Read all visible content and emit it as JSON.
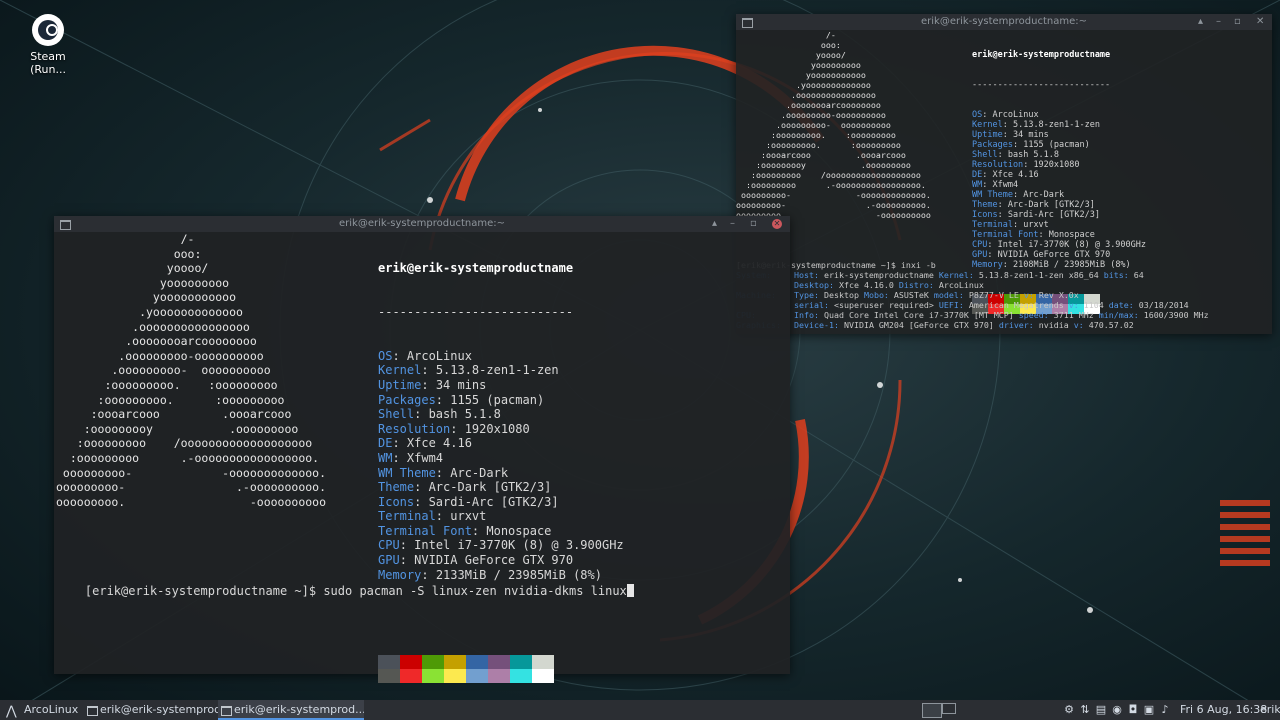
{
  "desktop": {
    "icon_label": "Steam (Run..."
  },
  "big_terminal": {
    "title": "erik@erik-systemproductname:~",
    "ascii_lines": [
      "                  /-",
      "                 ooo:",
      "                yoooo/",
      "               yooooooooo",
      "              yooooooooooo",
      "            .yooooooooooooo",
      "           .oooooooooooooooo",
      "          .oooooooarcoooooooo",
      "         .ooooooooo-oooooooooo",
      "        .ooooooooo-  oooooooooo",
      "       :ooooooooo.    :ooooooooo",
      "      :ooooooooo.      :ooooooooo",
      "     :oooarcooo         .oooarcooo",
      "    :ooooooooy           .ooooooooo",
      "   :ooooooooo    /ooooooooooooooooooo",
      "  :ooooooooo      .-ooooooooooooooooo.",
      " ooooooooo-             -ooooooooooooo.",
      "ooooooooo-                .-oooooooooo.",
      "ooooooooo.                  -oooooooooo"
    ],
    "user_host": "erik@erik-systemproductname",
    "separator": "---------------------------",
    "info": [
      {
        "key": "OS",
        "value": "ArcoLinux"
      },
      {
        "key": "Kernel",
        "value": "5.13.8-zen1-1-zen"
      },
      {
        "key": "Uptime",
        "value": "34 mins"
      },
      {
        "key": "Packages",
        "value": "1155 (pacman)"
      },
      {
        "key": "Shell",
        "value": "bash 5.1.8"
      },
      {
        "key": "Resolution",
        "value": "1920x1080"
      },
      {
        "key": "DE",
        "value": "Xfce 4.16"
      },
      {
        "key": "WM",
        "value": "Xfwm4"
      },
      {
        "key": "WM Theme",
        "value": "Arc-Dark"
      },
      {
        "key": "Theme",
        "value": "Arc-Dark [GTK2/3]"
      },
      {
        "key": "Icons",
        "value": "Sardi-Arc [GTK2/3]"
      },
      {
        "key": "Terminal",
        "value": "urxvt"
      },
      {
        "key": "Terminal Font",
        "value": "Monospace"
      },
      {
        "key": "CPU",
        "value": "Intel i7-3770K (8) @ 3.900GHz"
      },
      {
        "key": "GPU",
        "value": "NVIDIA GeForce GTX 970"
      },
      {
        "key": "Memory",
        "value": "2133MiB / 23985MiB (8%)"
      }
    ],
    "prompt": "[erik@erik-systemproductname ~]$ ",
    "command": "sudo pacman -S linux-zen nvidia-dkms linux"
  },
  "small_terminal": {
    "title": "erik@erik-systemproductname:~",
    "ascii_lines": [
      "                  /-",
      "                 ooo:",
      "                yoooo/",
      "               yooooooooo",
      "              yooooooooooo",
      "            .yooooooooooooo",
      "           .oooooooooooooooo",
      "          .oooooooarcoooooooo",
      "         .ooooooooo-oooooooooo",
      "        .ooooooooo-  oooooooooo",
      "       :ooooooooo.    :ooooooooo",
      "      :ooooooooo.      :ooooooooo",
      "     :oooarcooo         .oooarcooo",
      "    :ooooooooy           .ooooooooo",
      "   :ooooooooo    /ooooooooooooooooooo",
      "  :ooooooooo      .-ooooooooooooooooo.",
      " ooooooooo-             -ooooooooooooo.",
      "ooooooooo-                .-oooooooooo.",
      "ooooooooo.                  -oooooooooo"
    ],
    "user_host": "erik@erik-systemproductname",
    "separator": "---------------------------",
    "info": [
      {
        "key": "OS",
        "value": "ArcoLinux"
      },
      {
        "key": "Kernel",
        "value": "5.13.8-zen1-1-zen"
      },
      {
        "key": "Uptime",
        "value": "34 mins"
      },
      {
        "key": "Packages",
        "value": "1155 (pacman)"
      },
      {
        "key": "Shell",
        "value": "bash 5.1.8"
      },
      {
        "key": "Resolution",
        "value": "1920x1080"
      },
      {
        "key": "DE",
        "value": "Xfce 4.16"
      },
      {
        "key": "WM",
        "value": "Xfwm4"
      },
      {
        "key": "WM Theme",
        "value": "Arc-Dark"
      },
      {
        "key": "Theme",
        "value": "Arc-Dark [GTK2/3]"
      },
      {
        "key": "Icons",
        "value": "Sardi-Arc [GTK2/3]"
      },
      {
        "key": "Terminal",
        "value": "urxvt"
      },
      {
        "key": "Terminal Font",
        "value": "Monospace"
      },
      {
        "key": "CPU",
        "value": "Intel i7-3770K (8) @ 3.900GHz"
      },
      {
        "key": "GPU",
        "value": "NVIDIA GeForce GTX 970"
      },
      {
        "key": "Memory",
        "value": "2108MiB / 23985MiB (8%)"
      }
    ],
    "prompt_line": "[erik@erik-systemproductname ~]$ inxi -b",
    "inxi": [
      {
        "label": "System:",
        "text": [
          {
            "k": "Host:",
            "v": " erik-systemproductname "
          },
          {
            "k": "Kernel:",
            "v": " 5.13.8-zen1-1-zen x86_64 "
          },
          {
            "k": "bits:",
            "v": " 64"
          }
        ]
      },
      {
        "label": "",
        "text": [
          {
            "k": "Desktop:",
            "v": " Xfce 4.16.0 "
          },
          {
            "k": "Distro:",
            "v": " ArcoLinux"
          }
        ]
      },
      {
        "label": "Machine:",
        "text": [
          {
            "k": "Type:",
            "v": " Desktop "
          },
          {
            "k": "Mobo:",
            "v": " ASUSTeK "
          },
          {
            "k": "model:",
            "v": " P8Z77-V LE "
          },
          {
            "k": "v:",
            "v": " Rev X.0x"
          }
        ]
      },
      {
        "label": "",
        "text": [
          {
            "k": "serial:",
            "v": " <superuser required> "
          },
          {
            "k": "UEFI:",
            "v": " American Megatrends "
          },
          {
            "k": "v:",
            "v": " 1104 "
          },
          {
            "k": "date:",
            "v": " 03/18/2014"
          }
        ]
      },
      {
        "label": "CPU:",
        "text": [
          {
            "k": "Info:",
            "v": " Quad Core Intel Core i7-3770K [MT MCP] "
          },
          {
            "k": "speed:",
            "v": " 3711 MHz "
          },
          {
            "k": "min/max:",
            "v": " 1600/3900 MHz"
          }
        ]
      },
      {
        "label": "Graphics:",
        "text": [
          {
            "k": "Device-1:",
            "v": " NVIDIA GM204 [GeForce GTX 970] "
          },
          {
            "k": "driver:",
            "v": " nvidia "
          },
          {
            "k": "v:",
            "v": " 470.57.02"
          }
        ]
      }
    ]
  },
  "palette_top": [
    "#4b5159",
    "#cc0000",
    "#4e9a06",
    "#c4a000",
    "#3465a4",
    "#75507b",
    "#06989a",
    "#d3d7cf"
  ],
  "palette_bottom": [
    "#555753",
    "#ef2929",
    "#8ae234",
    "#fce94f",
    "#729fcf",
    "#ad7fa8",
    "#34e2e2",
    "#ffffff"
  ],
  "taskbar": {
    "menu_label": "ArcoLinux",
    "task1": "erik@erik-systemprod...",
    "task2": "erik@erik-systemprod...",
    "clock": "Fri  6 Aug, 16:38",
    "user": "erik"
  }
}
